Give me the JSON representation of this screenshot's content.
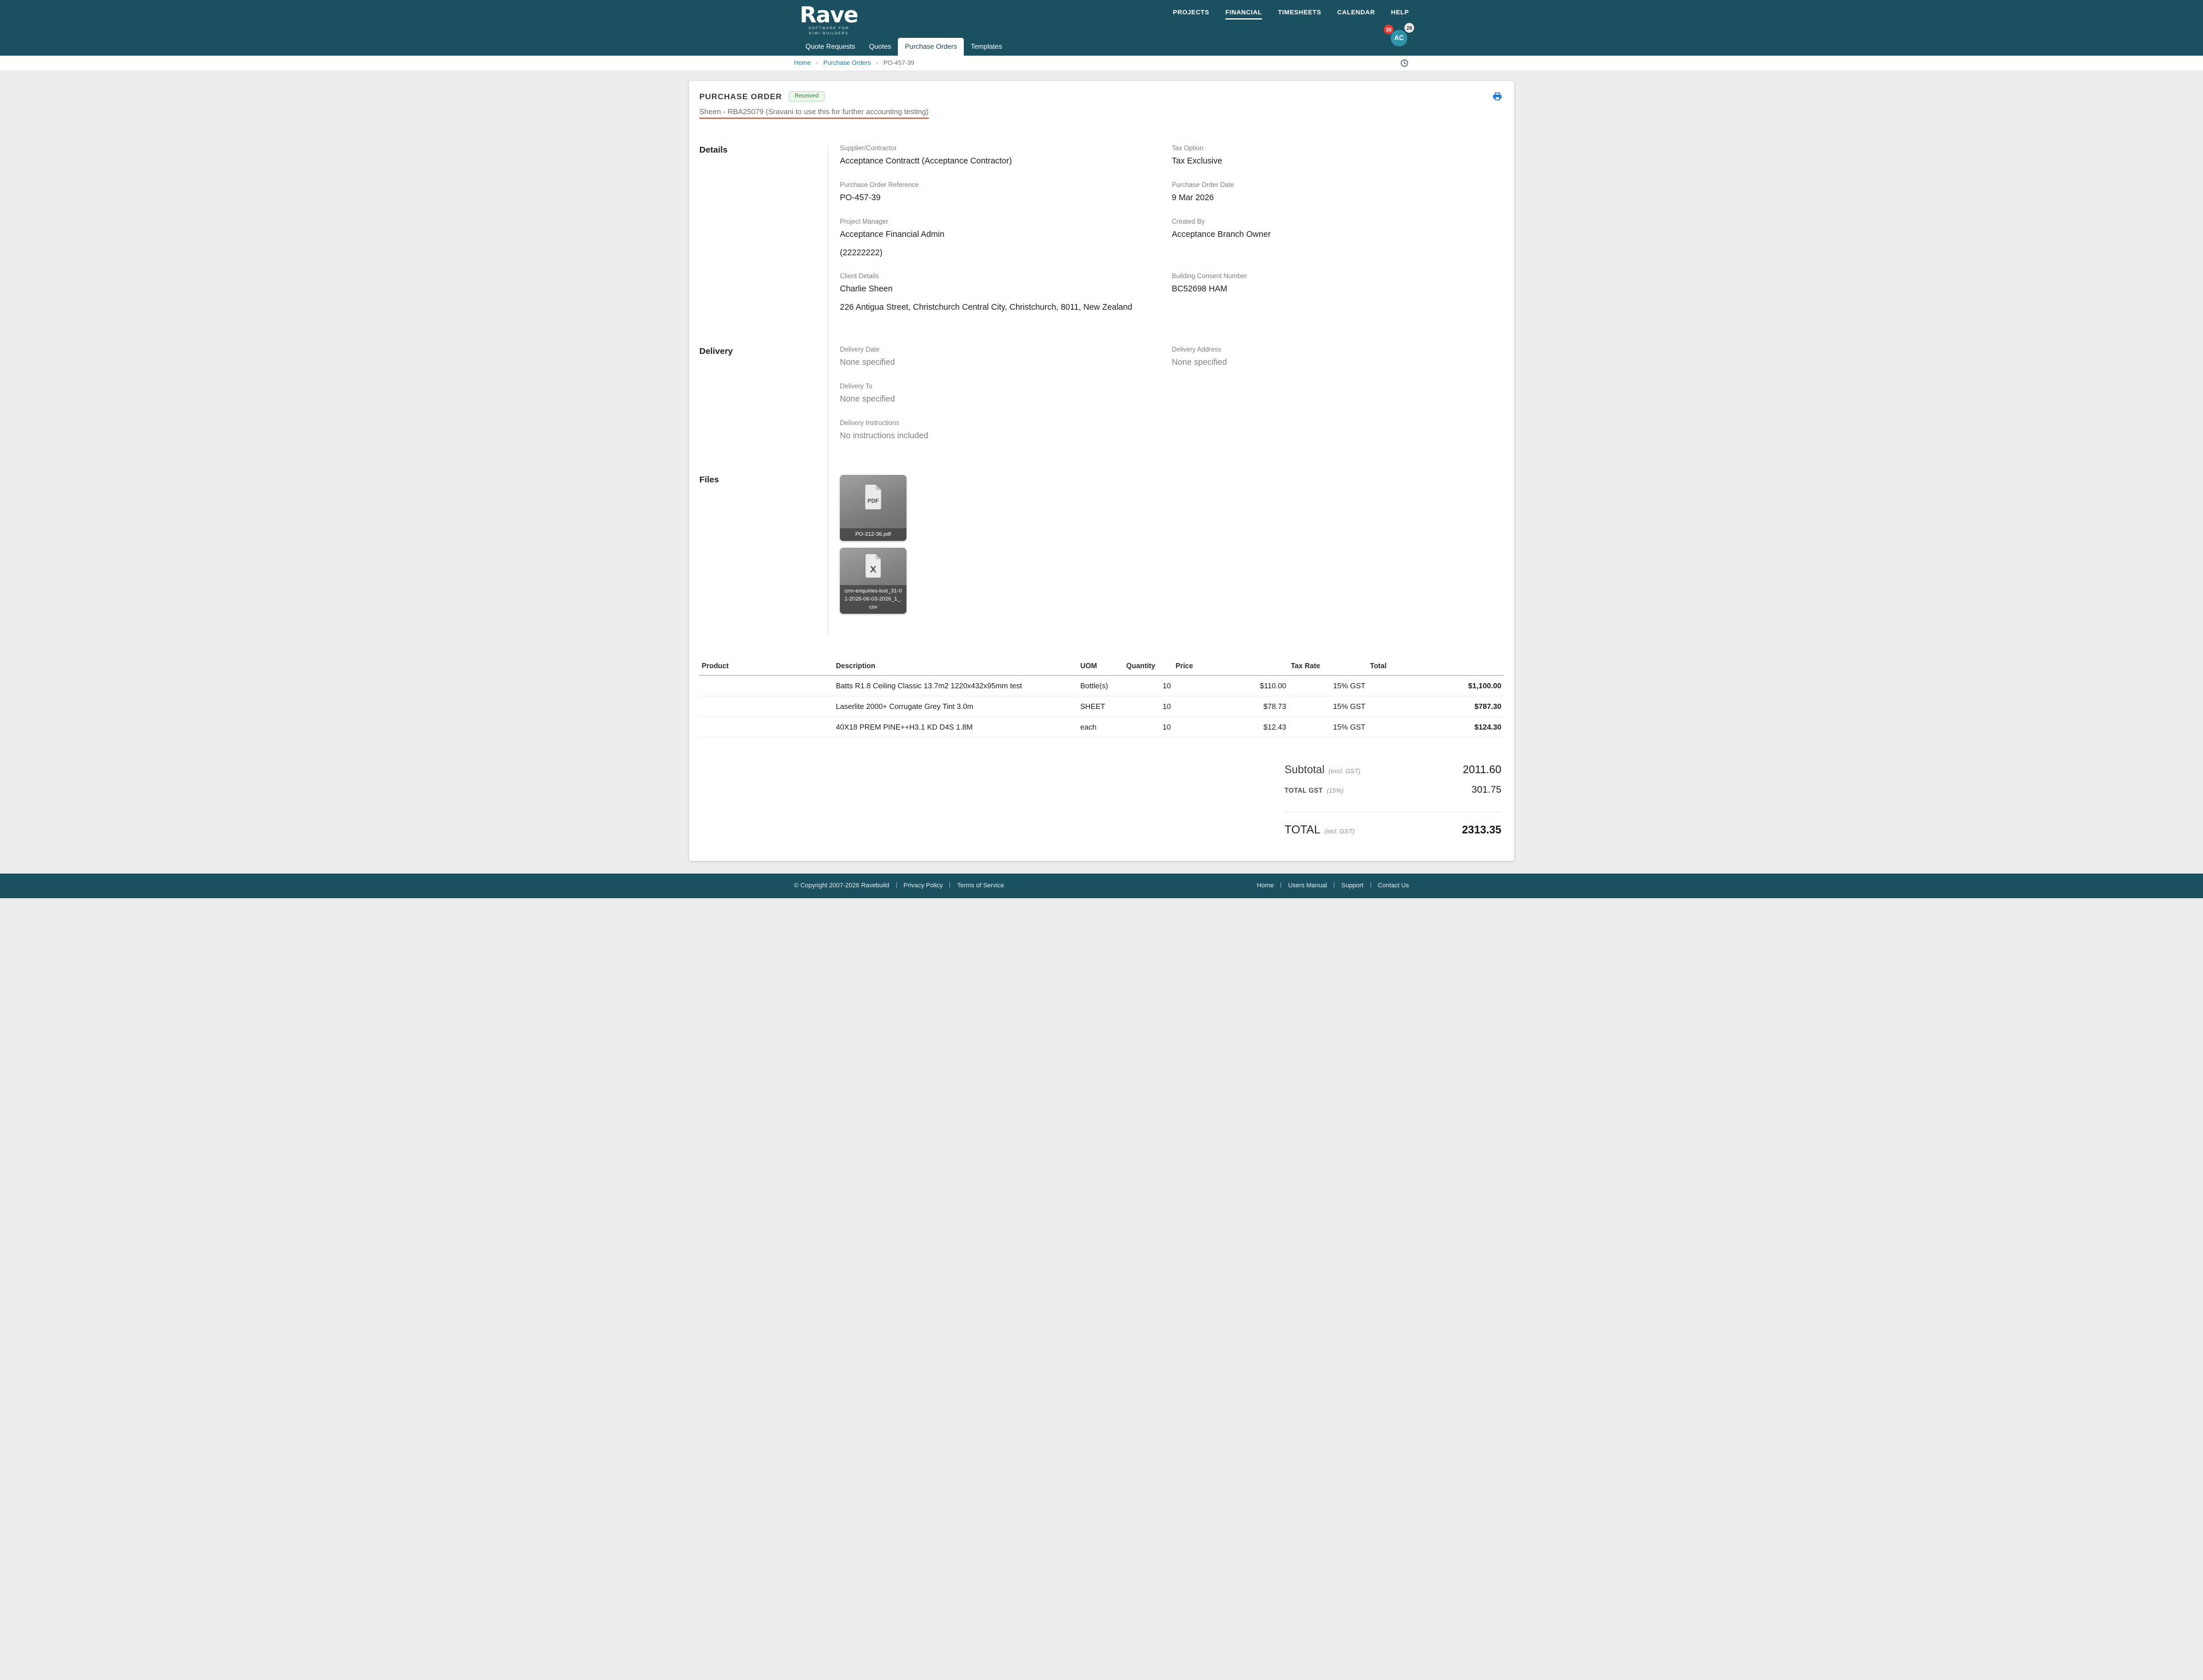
{
  "colors": {
    "header_teal": "#1B5060",
    "page_background": "#EDEDED",
    "accent_underline_orange": "#E0562F",
    "status_green": "#2E7D32",
    "link_teal": "#1F7A96",
    "print_icon_blue": "#1976D2",
    "badge_red": "#E53935",
    "avatar_teal": "#2E93A8"
  },
  "header": {
    "logo_text": "Rave",
    "logo_tagline_line1": "SOFTWARE FOR",
    "logo_tagline_line2": "KIWI BUILDERS",
    "nav": [
      {
        "label": "PROJECTS",
        "active": false
      },
      {
        "label": "FINANCIAL",
        "active": true
      },
      {
        "label": "TIMESHEETS",
        "active": false
      },
      {
        "label": "CALENDAR",
        "active": false
      },
      {
        "label": "HELP",
        "active": false
      }
    ],
    "tabs": [
      {
        "label": "Quote Requests",
        "active": false
      },
      {
        "label": "Quotes",
        "active": false
      },
      {
        "label": "Purchase Orders",
        "active": true
      },
      {
        "label": "Templates",
        "active": false
      }
    ],
    "badge_red_count": "30",
    "badge_gray_count": "28",
    "avatar_initials": "AC"
  },
  "breadcrumb": {
    "home": "Home",
    "section": "Purchase Orders",
    "current": "PO-457-39",
    "separator": "›"
  },
  "po": {
    "title": "PURCHASE ORDER",
    "status": "Received",
    "subtitle": "Sheen - RBA25079 (Sravani to use this for further accounting testing)"
  },
  "details": {
    "title": "Details",
    "supplier_label": "Supplier/Contractor",
    "supplier_value": "Acceptance Contractt (Acceptance Contractor)",
    "tax_label": "Tax Option",
    "tax_value": "Tax Exclusive",
    "po_ref_label": "Purchase Order Reference",
    "po_ref_value": "PO-457-39",
    "po_date_label": "Purchase Order Date",
    "po_date_value": "9 Mar 2026",
    "pm_label": "Project Manager",
    "pm_value": "Acceptance Financial Admin",
    "pm_phone": "(22222222)",
    "created_label": "Created By",
    "created_value": "Acceptance Branch Owner",
    "client_label": "Client Details",
    "client_name": "Charlie Sheen",
    "client_address": "226 Antigua Street, Christchurch Central City, Christchurch, 8011, New Zealand",
    "consent_label": "Building Consent Number",
    "consent_value": "BC52698 HAM"
  },
  "delivery": {
    "title": "Delivery",
    "date_label": "Delivery Date",
    "date_value": "None specified",
    "address_label": "Delivery Address",
    "address_value": "None specified",
    "to_label": "Delivery To",
    "to_value": "None specified",
    "instructions_label": "Delivery Instructions",
    "instructions_value": "No instructions included"
  },
  "files": {
    "title": "Files",
    "items": [
      {
        "name": "PO-212-36.pdf",
        "icon_label": "PDF"
      },
      {
        "name": "crm-enquiries-lost_31-01-2026-06-03-2026_1_.csv",
        "icon_label": "X"
      }
    ]
  },
  "table": {
    "headers": [
      "Product",
      "Description",
      "UOM",
      "Quantity",
      "Price",
      "Tax Rate",
      "Total"
    ],
    "rows": [
      {
        "product": "",
        "description": "Batts R1.8 Ceiling Classic 13.7m2 1220x432x95mm test",
        "uom": "Bottle(s)",
        "quantity": "10",
        "price": "$110.00",
        "tax_rate": "15% GST",
        "total": "$1,100.00"
      },
      {
        "product": "",
        "description": "Laserlite 2000+ Corrugate Grey Tint 3.0m",
        "uom": "SHEET",
        "quantity": "10",
        "price": "$78.73",
        "tax_rate": "15% GST",
        "total": "$787.30"
      },
      {
        "product": "",
        "description": "40X18 PREM PINE++H3.1 KD D4S 1.8M",
        "uom": "each",
        "quantity": "10",
        "price": "$12.43",
        "tax_rate": "15% GST",
        "total": "$124.30"
      }
    ]
  },
  "totals": {
    "subtotal_label": "Subtotal",
    "subtotal_note": "(excl. GST)",
    "subtotal_value": "2011.60",
    "gst_label": "TOTAL GST",
    "gst_note": "(15%)",
    "gst_value": "301.75",
    "total_label": "TOTAL",
    "total_note": "(incl. GST)",
    "total_value": "2313.35"
  },
  "footer": {
    "copyright": "© Copyright 2007-2026 Ravebuild",
    "privacy": "Privacy Policy",
    "terms": "Terms of Service",
    "links": [
      "Home",
      "Users Manual",
      "Support",
      "Contact Us"
    ]
  }
}
